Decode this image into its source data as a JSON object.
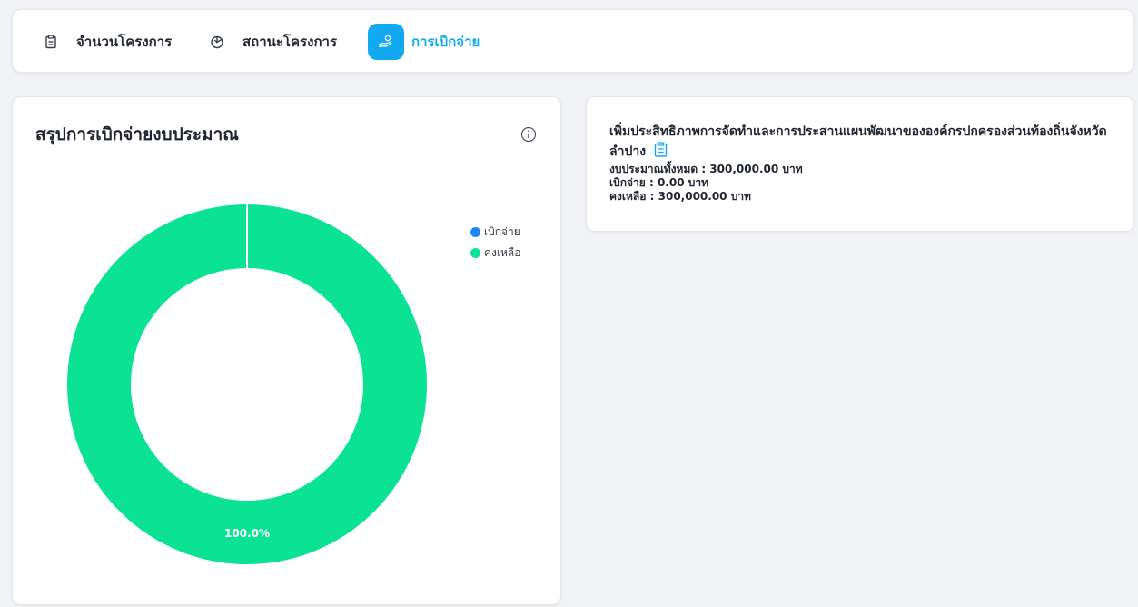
{
  "tabs": [
    {
      "label": "จำนวนโครงการ",
      "icon": "clipboard-icon",
      "active": false
    },
    {
      "label": "สถานะโครงการ",
      "icon": "pie-chart-icon",
      "active": false
    },
    {
      "label": "การเบิกจ่าย",
      "icon": "hand-coin-icon",
      "active": true
    }
  ],
  "summary_card": {
    "title": "สรุปการเบิกจ่ายงบประมาณ",
    "info_icon": "info-icon"
  },
  "chart_data": {
    "type": "pie",
    "categories": [
      "เบิกจ่าย",
      "คงเหลือ"
    ],
    "values": [
      0,
      300000
    ],
    "colors": [
      "#1a87f4",
      "#0ce293"
    ],
    "data_labels": [
      "",
      "100.0%"
    ],
    "legend_position": "top-right",
    "donut": true
  },
  "project_card": {
    "title": "เพิ่มประสิทธิภาพการจัดทำและการประสานแผนพัฒนาขององค์กรปกครองส่วนท้องถิ่นจังหวัดลำปาง",
    "clip_icon": "clipboard-icon",
    "budget_line": "งบประมาณทั้งหมด : 300,000.00 บาท",
    "spent_line": "เบิกจ่าย : 0.00 บาท",
    "remaining_line": "คงเหลือ : 300,000.00 บาท"
  },
  "colors": {
    "accent": "#13a9f0",
    "remaining": "#0ce293",
    "spent": "#1a87f4"
  }
}
